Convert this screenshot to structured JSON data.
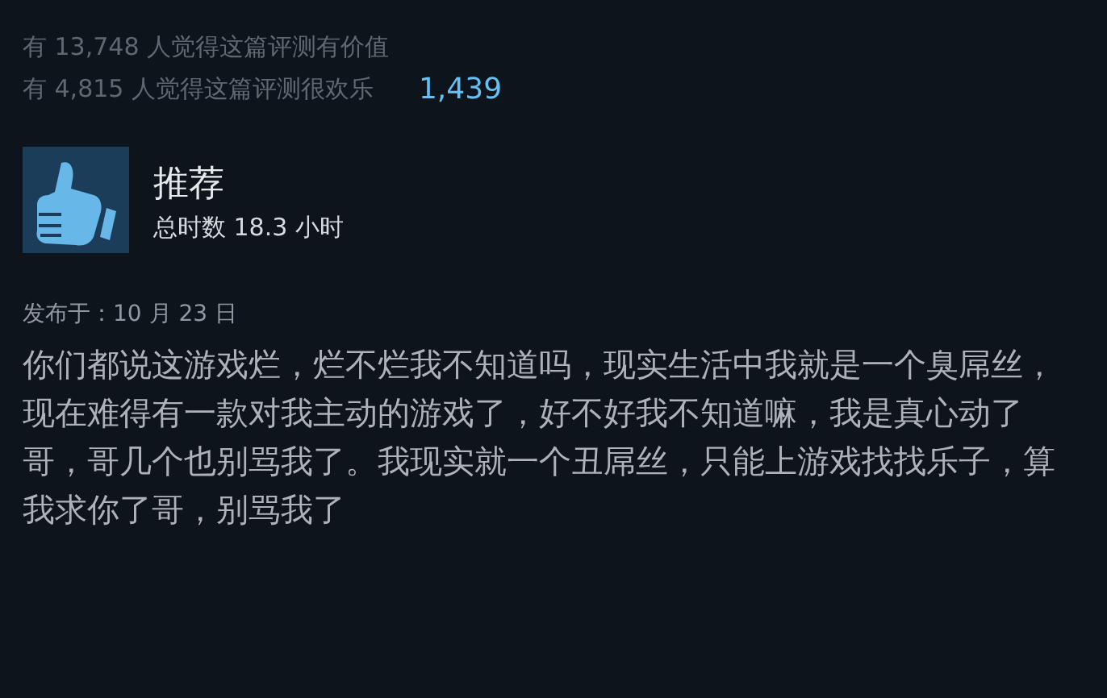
{
  "helpful": "有 13,748 人觉得这篇评测有价值",
  "funny": "有 4,815 人觉得这篇评测很欢乐",
  "award_count": "1,439",
  "verdict": {
    "kind": "recommended",
    "title": "推荐",
    "hours": "总时数 18.3 小时"
  },
  "posted": "发布于：10 月 23 日",
  "body": "你们都说这游戏烂，烂不烂我不知道吗，现实生活中我就是一个臭屌丝，现在难得有一款对我主动的游戏了，好不好我不知道嘛，我是真心动了哥，哥几个也别骂我了。我现实就一个丑屌丝，只能上游戏找找乐子，算我求你了哥，别骂我了"
}
